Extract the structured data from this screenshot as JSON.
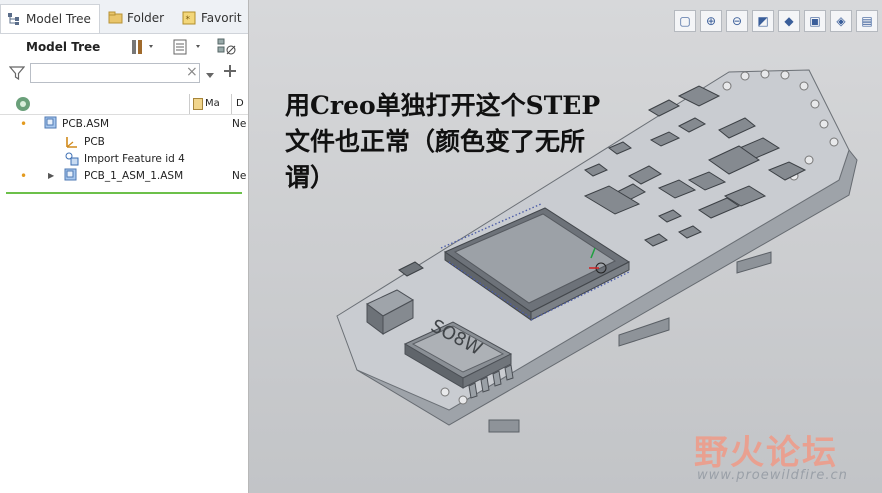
{
  "tabs": [
    {
      "label": "Model Tree",
      "icon": "model-tree-icon"
    },
    {
      "label": "Folder",
      "icon": "folder-icon"
    },
    {
      "label": "Favorit",
      "icon": "favorites-icon"
    }
  ],
  "toolbar": {
    "title": "Model Tree"
  },
  "filter": {
    "placeholder": "",
    "clear": "×"
  },
  "columns": {
    "col1": "Ma",
    "col2": "D"
  },
  "tree": [
    {
      "label": "PCB.ASM",
      "value": "Ne",
      "dot": "•"
    },
    {
      "label": "PCB",
      "value": "",
      "dot": ""
    },
    {
      "label": "Import Feature id 4",
      "value": "",
      "dot": ""
    },
    {
      "label": "PCB_1_ASM_1.ASM",
      "value": "Ne",
      "dot": "•",
      "expand": "▶"
    }
  ],
  "annotation": "用Creo单独打开这个STEP文件也正常（颜色变了无所谓）",
  "chip_label": "SO8W",
  "watermark": {
    "title": "野火论坛",
    "url": "www.proewildfire.cn"
  },
  "colors": {
    "accent": "#6cc04a",
    "board": "#c9ccd1"
  }
}
